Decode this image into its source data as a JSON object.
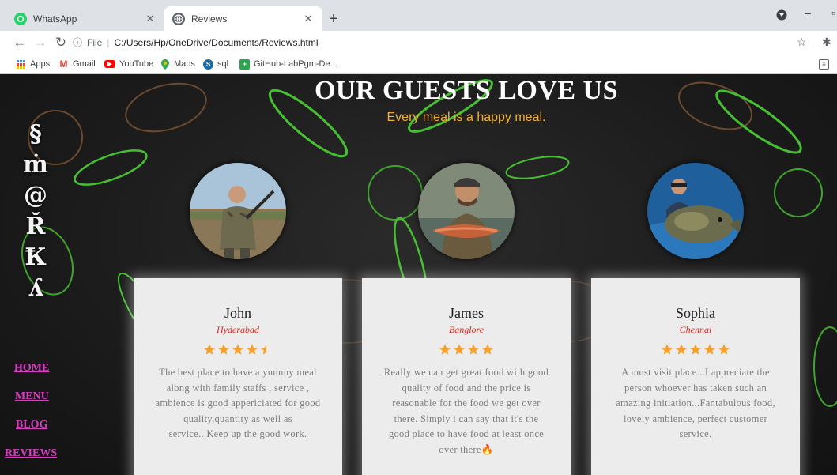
{
  "browser": {
    "tabs": [
      {
        "title": "WhatsApp",
        "active": false
      },
      {
        "title": "Reviews",
        "active": true
      }
    ],
    "url": {
      "scheme": "File",
      "path": "C:/Users/Hp/OneDrive/Documents/Reviews.html"
    },
    "bookmarks": [
      "Apps",
      "Gmail",
      "YouTube",
      "Maps",
      "sql",
      "GitHub-LabPgm-De..."
    ]
  },
  "page": {
    "brand_letters": [
      "§",
      "ṁ",
      "@",
      "Ř",
      "Ꝁ",
      "ʎ"
    ],
    "title": "OUR GUESTS LOVE US",
    "subtitle": "Every meal is a happy meal.",
    "nav": [
      "HOME",
      "MENU",
      "BLOG",
      "REVIEWS"
    ],
    "colors": {
      "subtitle": "#f2b038",
      "nav": "#d63fc0",
      "city": "#e02b1f",
      "star": "#f2a12e"
    },
    "reviews": [
      {
        "name": "John",
        "city": "Hyderabad",
        "rating": 4.5,
        "text": "The best place to have a yummy meal along with family staffs , service , ambience is good appericiated for good quality,quantity as well as service...Keep up the good work."
      },
      {
        "name": "James",
        "city": "Banglore",
        "rating": 4,
        "text": "Really we can get great food with good quality of food and the price is reasonable for the food we get over there. Simply i can say that it's the good place to have food at least once over there🔥"
      },
      {
        "name": "Sophia",
        "city": "Chennai",
        "rating": 5,
        "text": "A must visit place...I appreciate the person whoever has taken such an amazing initiation...Fantabulous food, lovely ambience, perfect customer service."
      }
    ]
  }
}
